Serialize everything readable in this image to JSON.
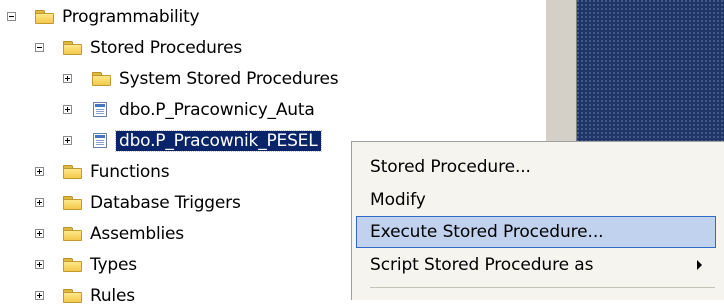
{
  "tree": {
    "items": [
      {
        "label": "Programmability",
        "expanded": true,
        "icon": "folder-icon"
      },
      {
        "label": "Stored Procedures",
        "expanded": true,
        "icon": "folder-icon"
      },
      {
        "label": "System Stored Procedures",
        "expanded": false,
        "icon": "folder-icon"
      },
      {
        "label": "dbo.P_Pracownicy_Auta",
        "expanded": false,
        "icon": "stored-procedure-icon"
      },
      {
        "label": "dbo.P_Pracownik_PESEL",
        "expanded": false,
        "icon": "stored-procedure-icon",
        "selected": true
      },
      {
        "label": "Functions",
        "expanded": false,
        "icon": "folder-icon"
      },
      {
        "label": "Database Triggers",
        "expanded": false,
        "icon": "folder-icon"
      },
      {
        "label": "Assemblies",
        "expanded": false,
        "icon": "folder-icon"
      },
      {
        "label": "Types",
        "expanded": false,
        "icon": "folder-icon"
      },
      {
        "label": "Rules",
        "expanded": false,
        "icon": "folder-icon"
      }
    ]
  },
  "context_menu": {
    "items": [
      {
        "label": "Stored Procedure...",
        "has_submenu": false
      },
      {
        "label": "Modify",
        "has_submenu": false
      },
      {
        "label": "Execute Stored Procedure...",
        "has_submenu": false,
        "highlighted": true
      },
      {
        "label": "Script Stored Procedure as",
        "has_submenu": true
      }
    ]
  },
  "colors": {
    "selection": "#0a246a",
    "menu_highlight": "#c1d2ee",
    "menu_highlight_border": "#316ac5",
    "side_panel": "#1f3566"
  }
}
